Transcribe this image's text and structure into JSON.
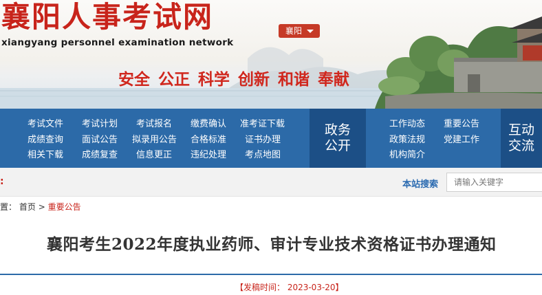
{
  "header": {
    "title": "襄阳人事考试网",
    "subtitle": "xiangyang personnel examination network",
    "city": "襄阳",
    "slogan": "安全  公正  科学  创新  和谐  奉献"
  },
  "nav": {
    "col1": [
      "考试文件",
      "成绩查询",
      "相关下载"
    ],
    "col2": [
      "考试计划",
      "面试公告",
      "成绩复查"
    ],
    "col3": [
      "考试报名",
      "拟录用公告",
      "信息更正"
    ],
    "col4": [
      "缴费确认",
      "合格标准",
      "违纪处理"
    ],
    "col5": [
      "准考证下载",
      "证书办理",
      "考点地图"
    ],
    "block1": [
      "政务",
      "公开"
    ],
    "col6": [
      "工作动态",
      "政策法规",
      "机构简介"
    ],
    "col7": [
      "重要公告",
      "党建工作"
    ],
    "block2": [
      "互动",
      "交流"
    ]
  },
  "search": {
    "label": "本站搜索",
    "placeholder": "请输入关键字"
  },
  "breadcrumb": {
    "prefix": "置：",
    "home": "首页",
    "sep": ">",
    "current": "重要公告"
  },
  "article": {
    "title": "襄阳考生2022年度执业药师、审计专业技术资格证书办理通知",
    "date_text": "【发稿时间： 2023-03-20】"
  },
  "colors": {
    "brand_red": "#c8241b",
    "nav_blue": "#2c6aa8",
    "nav_dark": "#1c4f86"
  }
}
